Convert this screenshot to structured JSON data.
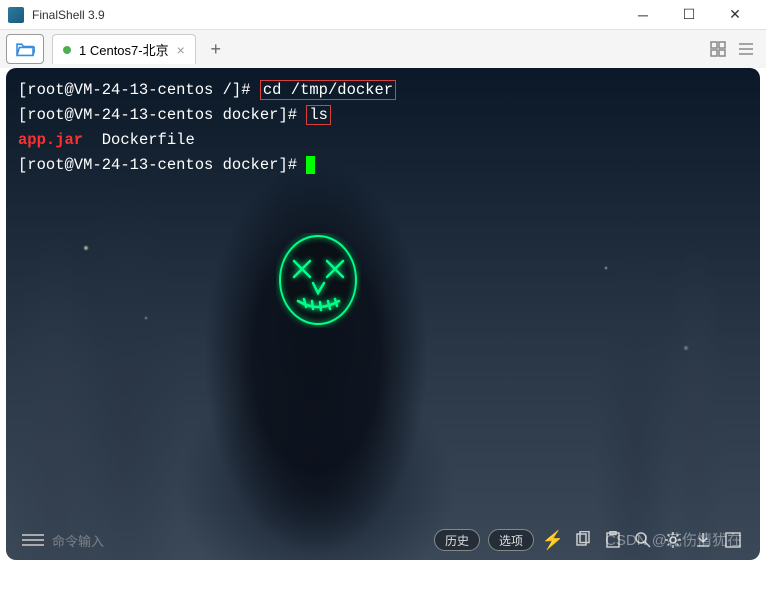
{
  "app": {
    "title": "FinalShell 3.9"
  },
  "tabs": {
    "active": {
      "label": "1 Centos7-北京"
    }
  },
  "terminal": {
    "lines": {
      "l1_prompt": "[root@VM-24-13-centos /]#",
      "l1_cmd": "cd /tmp/docker",
      "l2_prompt": "[root@VM-24-13-centos docker]#",
      "l2_cmd": "ls",
      "l3_file1": "app.jar",
      "l3_file2": "Dockerfile",
      "l4_prompt": "[root@VM-24-13-centos docker]#"
    }
  },
  "bottombar": {
    "cmd_placeholder": "命令输入",
    "history_label": "历史",
    "options_label": "选项"
  },
  "watermark": {
    "text": "CSDN @花伤情犹在"
  }
}
